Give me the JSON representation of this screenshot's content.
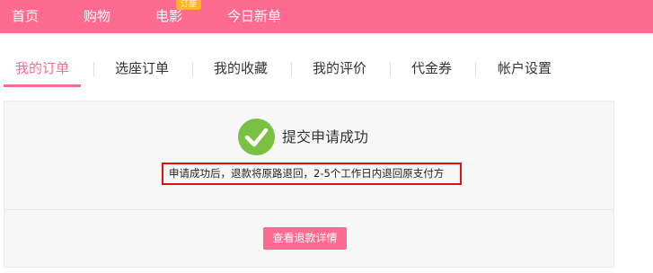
{
  "topnav": {
    "items": [
      "首页",
      "购物",
      "电影",
      "今日新单"
    ],
    "badge": "订座"
  },
  "tabs": {
    "items": [
      "我的订单",
      "选座订单",
      "我的收藏",
      "我的评价",
      "代金券",
      "帐户设置"
    ],
    "active_index": 0
  },
  "result": {
    "icon": "check-circle-icon",
    "title": "提交申请成功",
    "notice": "申请成功后，退款将原路退回，2-5个工作日内退回原支付方",
    "detail_button": "查看退款详情"
  },
  "colors": {
    "brand": "#fe6b91",
    "success": "#7ac143",
    "highlight_border": "#e01010",
    "badge": "#ffb32c"
  }
}
